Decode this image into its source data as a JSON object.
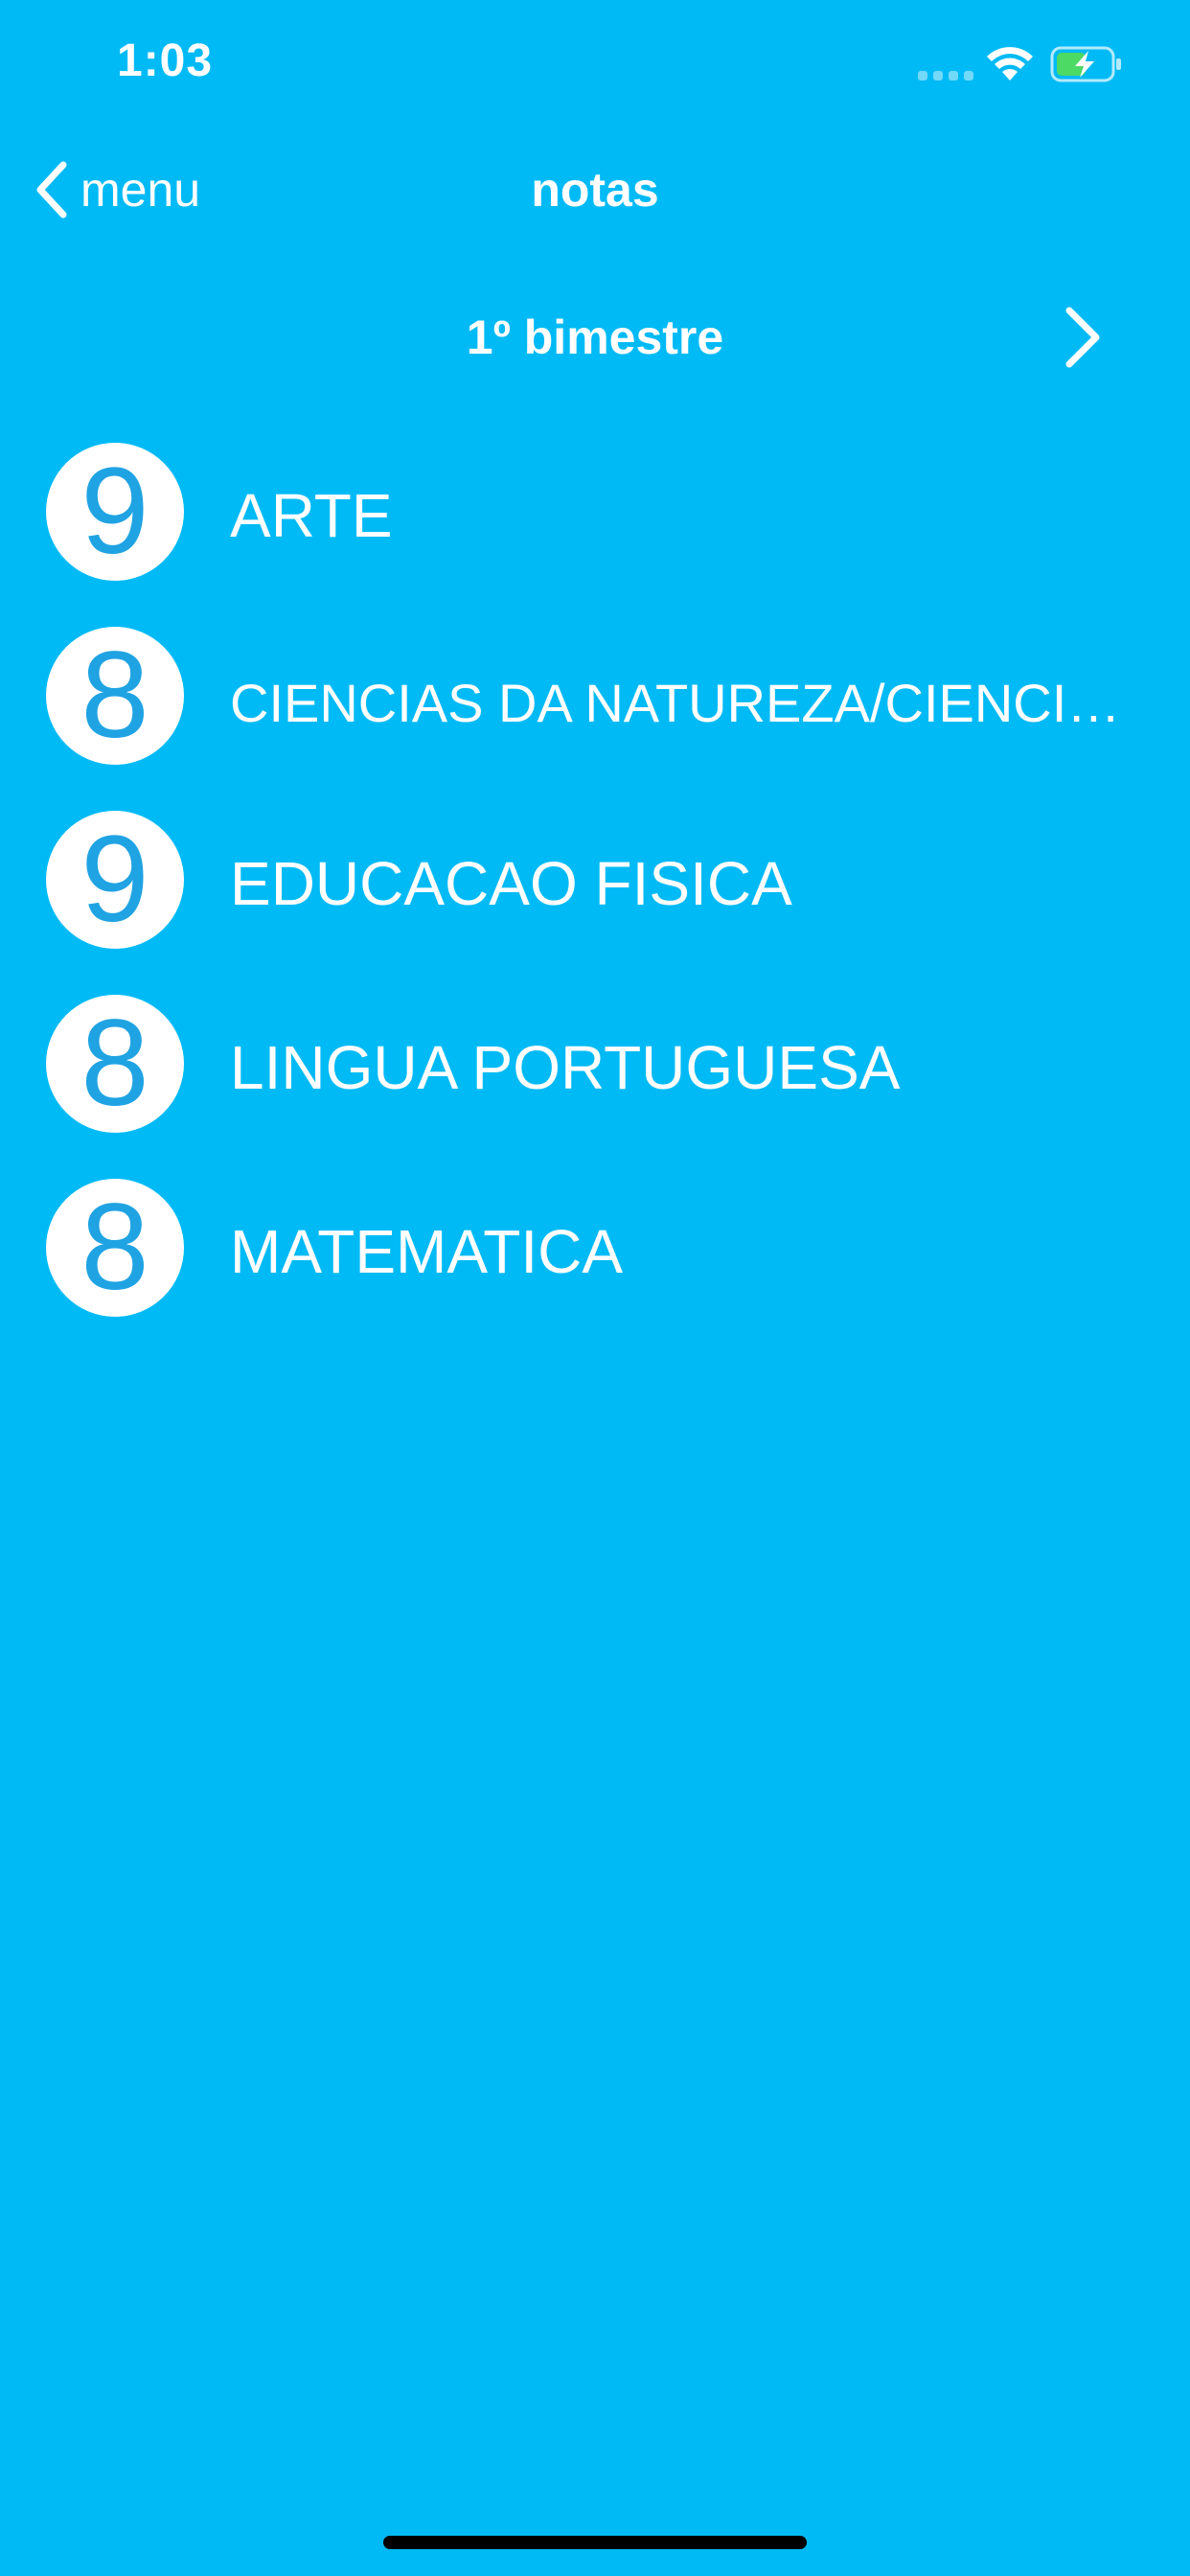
{
  "status_bar": {
    "time": "1:03",
    "icons": [
      "cellular-signal-icon",
      "wifi-icon",
      "battery-charging-icon"
    ],
    "battery_color": "#4CD964"
  },
  "nav": {
    "back_label": "menu",
    "title": "notas"
  },
  "period": {
    "label": "1º bimestre"
  },
  "grades": [
    {
      "grade": "9",
      "subject": "ARTE"
    },
    {
      "grade": "8",
      "subject": "CIENCIAS DA NATUREZA/CIENCIAS"
    },
    {
      "grade": "9",
      "subject": "EDUCACAO FISICA"
    },
    {
      "grade": "8",
      "subject": "LINGUA PORTUGUESA"
    },
    {
      "grade": "8",
      "subject": "MATEMATICA"
    }
  ],
  "colors": {
    "background": "#00BAF5",
    "grade_text": "#1FA3E3",
    "foreground": "#FFFFFF"
  }
}
